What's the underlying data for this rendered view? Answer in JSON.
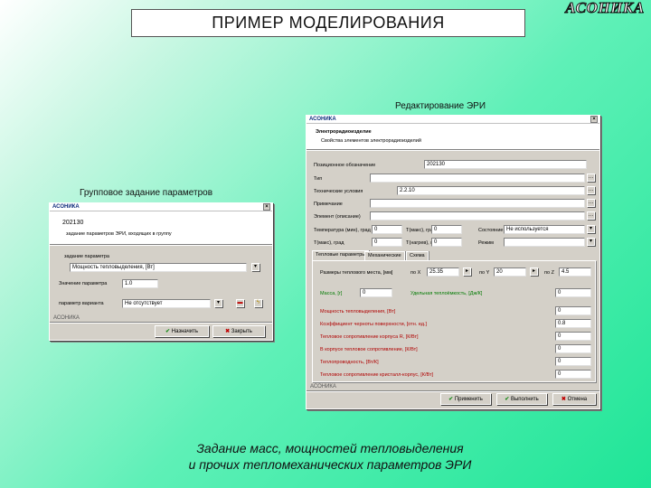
{
  "header": {
    "title": "ПРИМЕР МОДЕЛИРОВАНИЯ",
    "brand": "АСОНИКА"
  },
  "captions": {
    "right_window": "Редактирование ЭРИ",
    "left_window": "Групповое задание параметров",
    "bottom_line1": "Задание масс, мощностей тепловыделения",
    "bottom_line2": "и прочих тепломеханических параметров ЭРИ"
  },
  "left_dialog": {
    "title": "АСОНИКА",
    "close": "×",
    "code": "202130",
    "subtitle": "задание параметров ЭРИ, входящих в группу",
    "group_label": "задание параметра",
    "param_select": "Мощность тепловыделения, [Вт]",
    "value_label": "Значение параметра",
    "value": "1.0",
    "variant_label": "параметр варианта",
    "variant_select": "Не отсутствует",
    "status": "АСОНИКА",
    "apply_label": "Назначить",
    "close_label": "Закрыть"
  },
  "right_dialog": {
    "title": "АСОНИКА",
    "close": "×",
    "header_title": "Электрорадиоизделие",
    "header_sub": "Свойства элементов электрорадиоизделий",
    "fields": {
      "designation_label": "Позиционное обозначение",
      "designation_value": "202130",
      "type_label": "Тип",
      "tech_label": "Технические условия",
      "tech_value": "2.2.10",
      "note_label": "Примечание",
      "element_label": "Элемент (описание)",
      "temp_label": "Температура (мин), град",
      "temp_value": "0",
      "temp_label2": "Т(макс), град",
      "temp_value2": "0",
      "state_label": "Состояние",
      "state_value": "Не используется",
      "tmax_label": "Т(макс), град",
      "tmax_value": "0",
      "tmax_label2": "Т(нагрев), град",
      "tmax_value2": "0",
      "mode_label": "Режим",
      "mode_value": ""
    },
    "tabs": [
      "Тепловые параметры",
      "Механические",
      "Схема"
    ],
    "dims_label": "Размеры теплового места, [мм]",
    "dim_x_label": "по X",
    "dim_x_value": "25.35",
    "dim_y_label": "по Y",
    "dim_y_value": "20",
    "dim_z_label": "по Z",
    "dim_z_value": "4.5",
    "mass_label": "Масса, [г]",
    "mass_value": "0",
    "capacity_label": "Удельная теплоёмкость, [Дж/К]",
    "capacity_value": "0",
    "rows": [
      {
        "label": "Мощность тепловыделения, [Вт]",
        "value": "0"
      },
      {
        "label": "Коэффициент черноты поверхности, [отн. ед.]",
        "value": "0.8"
      },
      {
        "label": "Тепловое сопротивление корпуса R, [К/Вт]",
        "value": "0"
      },
      {
        "label": "В корпусе тепловое сопротивление, [К/Вт]",
        "value": "0"
      },
      {
        "label": "Теплопроводность, [Вт/К]",
        "value": "0"
      },
      {
        "label": "Тепловое сопротивление кристалл-корпус, [К/Вт]",
        "value": "0"
      }
    ],
    "status": "АСОНИКА",
    "apply_label": "Применить",
    "ok_label": "Выполнить",
    "cancel_label": "Отмена"
  },
  "colors": {
    "accent_check": "#1a8a1a",
    "accent_cross": "#c00000",
    "label_red": "#b00000",
    "label_green": "#007a00"
  }
}
